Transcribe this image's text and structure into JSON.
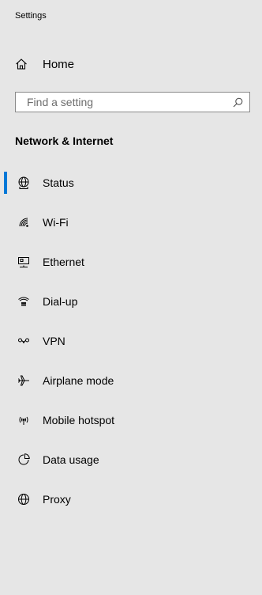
{
  "window": {
    "title": "Settings"
  },
  "home": {
    "label": "Home",
    "icon": "home-icon"
  },
  "search": {
    "placeholder": "Find a setting",
    "value": "",
    "icon": "search-icon"
  },
  "section": {
    "title": "Network & Internet"
  },
  "nav": {
    "selected": "Status",
    "accent_color": "#0078d7",
    "items": [
      {
        "label": "Status",
        "icon": "globe-status-icon"
      },
      {
        "label": "Wi-Fi",
        "icon": "wifi-icon"
      },
      {
        "label": "Ethernet",
        "icon": "ethernet-icon"
      },
      {
        "label": "Dial-up",
        "icon": "dialup-icon"
      },
      {
        "label": "VPN",
        "icon": "vpn-icon"
      },
      {
        "label": "Airplane mode",
        "icon": "airplane-icon"
      },
      {
        "label": "Mobile hotspot",
        "icon": "mobile-hotspot-icon"
      },
      {
        "label": "Data usage",
        "icon": "data-usage-icon"
      },
      {
        "label": "Proxy",
        "icon": "globe-proxy-icon"
      }
    ]
  }
}
